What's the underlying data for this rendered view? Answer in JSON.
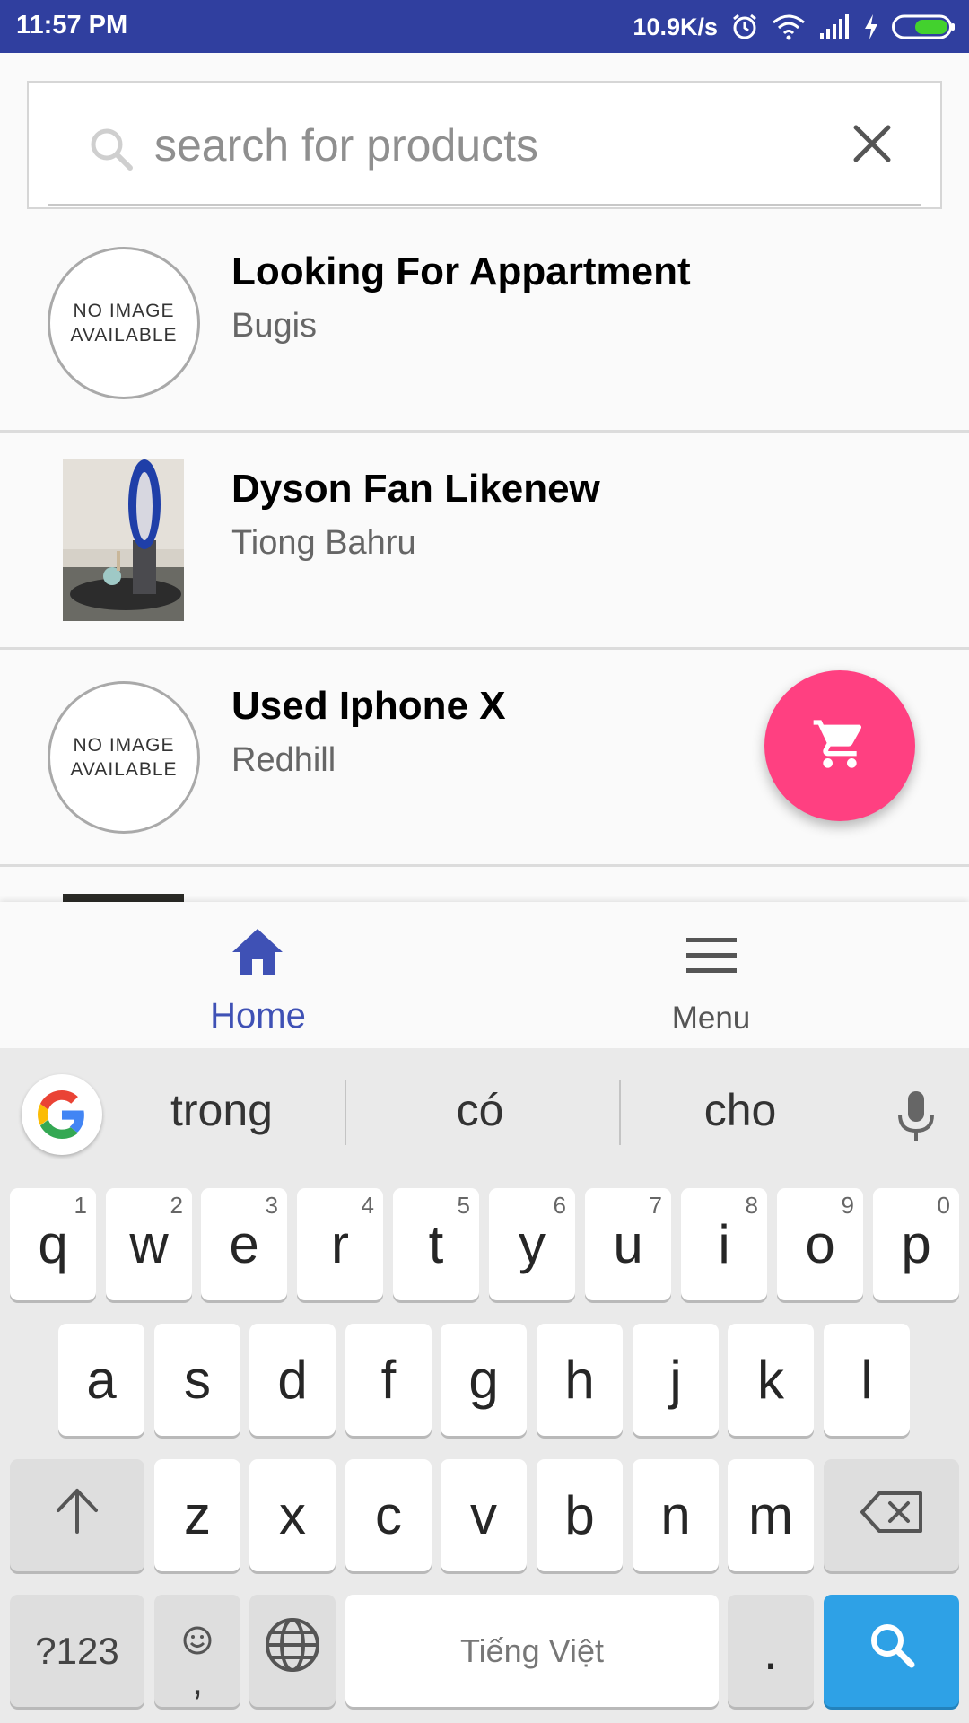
{
  "status_bar": {
    "time": "11:57 PM",
    "net_speed": "10.9K/s",
    "icons": [
      "alarm-icon",
      "wifi-icon",
      "signal-icon",
      "charging-icon",
      "battery-icon"
    ]
  },
  "search": {
    "placeholder": "search for products",
    "icon": "search-icon",
    "clear_icon": "close-icon"
  },
  "no_image_text": {
    "line1": "NO IMAGE",
    "line2": "AVAILABLE"
  },
  "listings": [
    {
      "title": "Looking For Appartment",
      "location": "Bugis",
      "image": "none"
    },
    {
      "title": "Dyson Fan Likenew",
      "location": "Tiong Bahru",
      "image": "photo"
    },
    {
      "title": "Used Iphone X",
      "location": "Redhill",
      "image": "none"
    }
  ],
  "fab": {
    "icon": "cart-icon",
    "color": "#ff4081"
  },
  "bottom_nav": {
    "home": {
      "label": "Home",
      "icon": "home-icon",
      "active": true
    },
    "menu": {
      "label": "Menu",
      "icon": "hamburger-icon",
      "active": false
    }
  },
  "keyboard": {
    "suggestions": [
      "trong",
      "có",
      "cho"
    ],
    "row1": [
      {
        "key": "q",
        "hint": "1"
      },
      {
        "key": "w",
        "hint": "2"
      },
      {
        "key": "e",
        "hint": "3"
      },
      {
        "key": "r",
        "hint": "4"
      },
      {
        "key": "t",
        "hint": "5"
      },
      {
        "key": "y",
        "hint": "6"
      },
      {
        "key": "u",
        "hint": "7"
      },
      {
        "key": "i",
        "hint": "8"
      },
      {
        "key": "o",
        "hint": "9"
      },
      {
        "key": "p",
        "hint": "0"
      }
    ],
    "row2": [
      "a",
      "s",
      "d",
      "f",
      "g",
      "h",
      "j",
      "k",
      "l"
    ],
    "row3": [
      "z",
      "x",
      "c",
      "v",
      "b",
      "n",
      "m"
    ],
    "symbols_label": "?123",
    "comma_label": ",",
    "space_label": "Tiếng Việt",
    "period_label": "."
  },
  "colors": {
    "status_bar": "#303f9f",
    "accent": "#3f51b5",
    "search_key": "#2ea1e6"
  }
}
